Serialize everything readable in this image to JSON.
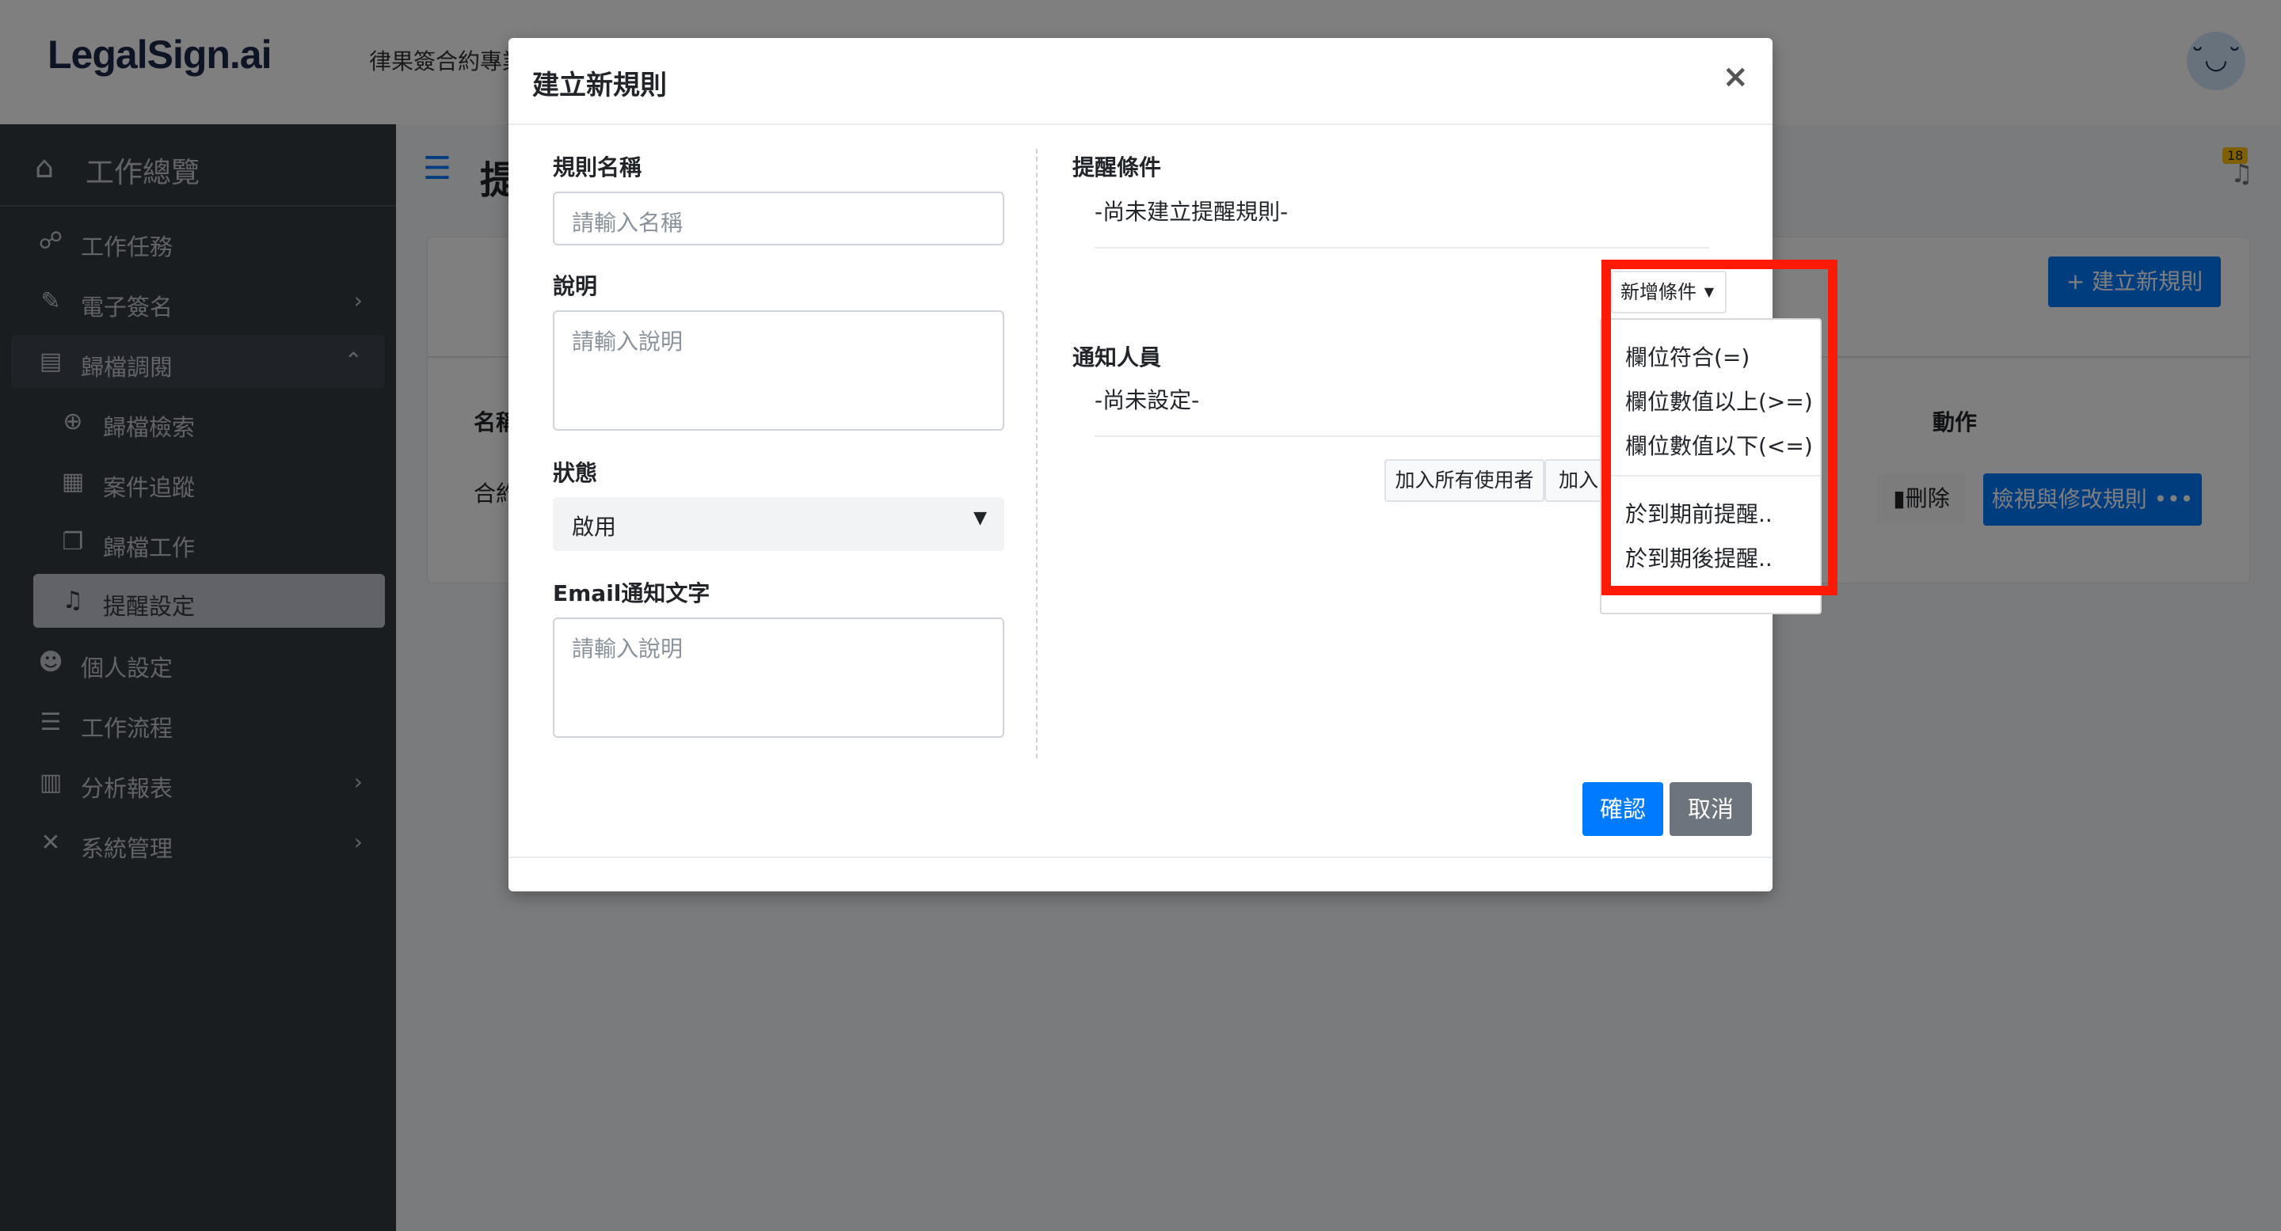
{
  "header": {
    "logo": "LegalSign.ai",
    "tagline": "律果簽合約專業",
    "avatar_face": "˘◡˘"
  },
  "sidebar": {
    "dashboard": "工作總覽",
    "items": [
      {
        "label": "工作任務",
        "icon": "handshake-icon"
      },
      {
        "label": "電子簽名",
        "icon": "signature-icon",
        "chevron": "›"
      },
      {
        "label": "歸檔調閱",
        "icon": "archive-icon",
        "chevron": "⌃"
      },
      {
        "label": "歸檔檢索",
        "icon": "search-plus-icon"
      },
      {
        "label": "案件追蹤",
        "icon": "calendar-check-icon"
      },
      {
        "label": "歸檔工作",
        "icon": "copy-icon"
      },
      {
        "label": "提醒設定",
        "icon": "bell-icon"
      },
      {
        "label": "個人設定",
        "icon": "user-cog-icon"
      },
      {
        "label": "工作流程",
        "icon": "tasks-icon"
      },
      {
        "label": "分析報表",
        "icon": "chart-bar-icon",
        "chevron": "›"
      },
      {
        "label": "系統管理",
        "icon": "tools-icon",
        "chevron": "›"
      }
    ]
  },
  "page": {
    "title": "提",
    "bell_count": "18",
    "new_rule_button": "建立新規則",
    "col_name": "名稱",
    "col_action": "動作",
    "row_name": "合約",
    "delete_button": "刪除",
    "view_button": "檢視與修改規則 •••"
  },
  "modal": {
    "title": "建立新規則",
    "close": "×",
    "rule_name_label": "規則名稱",
    "rule_name_placeholder": "請輸入名稱",
    "desc_label": "說明",
    "desc_placeholder": "請輸入說明",
    "status_label": "狀態",
    "status_value": "啟用",
    "email_label": "Email通知文字",
    "email_placeholder": "請輸入說明",
    "conditions_label": "提醒條件",
    "conditions_empty": "-尚未建立提醒規則-",
    "add_condition": "新增條件",
    "notify_label": "通知人員",
    "notify_empty": "-尚未設定-",
    "add_all_users": "加入所有使用者",
    "add_partial": "加入",
    "confirm": "確認",
    "cancel": "取消"
  },
  "dropdown": {
    "items": [
      "欄位符合(=)",
      "欄位數值以上(>=)",
      "欄位數值以下(<=)",
      "於到期前提醒..",
      "於到期後提醒.."
    ]
  },
  "colors": {
    "sidebar_bg": "#343a40",
    "primary": "#007bff",
    "secondary": "#6c757d",
    "highlight_box": "#ff1a05"
  }
}
